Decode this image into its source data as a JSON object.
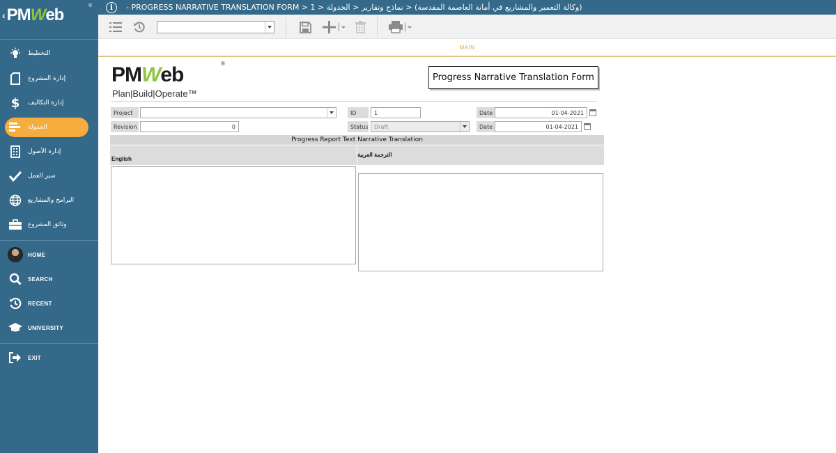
{
  "app": {
    "logo_text": "PMWeb",
    "breadcrumb": "(وكالة التعمير والمشاريع في أمانة العاصمة المقدسة) < نماذج وتقارير < الجدولة < PROGRESS NARRATIVE TRANSLATION FORM > 1 -"
  },
  "sidebar": {
    "items": [
      {
        "label": "التخطيط",
        "icon": "lightbulb-icon"
      },
      {
        "label": "إدارة المشروع",
        "icon": "document-icon"
      },
      {
        "label": "إدارة التكاليف",
        "icon": "dollar-icon"
      },
      {
        "label": "الجدولة",
        "icon": "schedule-icon",
        "active": true
      },
      {
        "label": "إدارة الأصول",
        "icon": "building-icon"
      },
      {
        "label": "سير العمل",
        "icon": "checkmark-icon"
      },
      {
        "label": "البرامج والمشاريع",
        "icon": "globe-icon"
      },
      {
        "label": "وثائق المشروع",
        "icon": "briefcase-icon"
      }
    ],
    "bottom": [
      {
        "label": "HOME",
        "icon": "avatar"
      },
      {
        "label": "SEARCH",
        "icon": "search-icon"
      },
      {
        "label": "RECENT",
        "icon": "recent-icon"
      },
      {
        "label": "UNIVERSITY",
        "icon": "graduation-cap-icon"
      }
    ],
    "exit_label": "EXIT",
    "colors": {
      "bg": "#35698a",
      "active": "#f6ad3f"
    }
  },
  "toolbar": {
    "select_value": ""
  },
  "tabs": {
    "main": "MAIN"
  },
  "form": {
    "logo": {
      "tagline": "Plan|Build|Operate™"
    },
    "title": "Progress Narrative Translation Form",
    "labels": {
      "project": "Project",
      "revision": "Revision",
      "id": "ID",
      "status": "Status",
      "date1": "Date",
      "date2": "Date"
    },
    "values": {
      "project": "",
      "revision": "0",
      "id": "1",
      "status": "Draft",
      "date1": "01-04-2021",
      "date2": "01-04-2021"
    },
    "section_title": "Progress Report Text Narrative Translation",
    "columns": {
      "english": "English",
      "arabic": "الترجمة العربية"
    },
    "english_text": "",
    "arabic_text": ""
  }
}
